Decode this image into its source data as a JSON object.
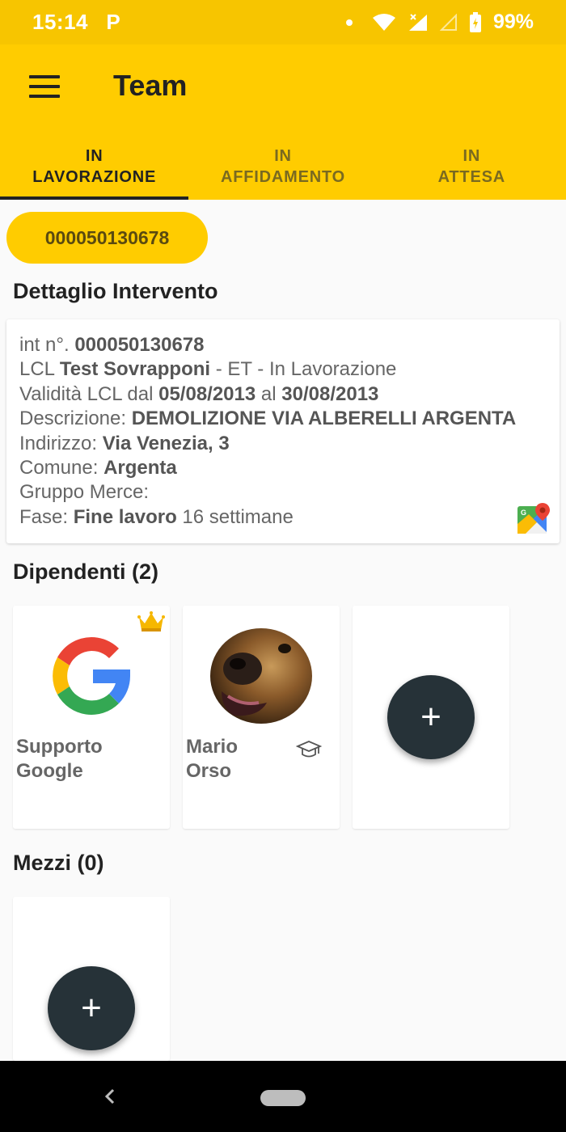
{
  "status_bar": {
    "time": "15:14",
    "parking_glyph": "P",
    "battery": "99%"
  },
  "app_bar": {
    "title": "Team",
    "menu_icon": "menu-icon"
  },
  "tabs": [
    {
      "line1": "IN",
      "line2": "LAVORAZIONE",
      "active": true
    },
    {
      "line1": "IN",
      "line2": "AFFIDAMENTO",
      "active": false
    },
    {
      "line1": "IN",
      "line2": "ATTESA",
      "active": false
    }
  ],
  "chip": {
    "label": "000050130678"
  },
  "detail": {
    "section_title": "Dettaglio Intervento",
    "int_label": "int n°.",
    "int_value": "000050130678",
    "lcl_label": "LCL",
    "lcl_value": "Test Sovrapponi",
    "lcl_suffix": "- ET - In Lavorazione",
    "validity_label": "Validità LCL dal",
    "validity_from": "05/08/2013",
    "validity_al": "al",
    "validity_to": "30/08/2013",
    "descrizione_label": "Descrizione:",
    "descrizione_value": "DEMOLIZIONE VIA ALBERELLI ARGENTA",
    "indirizzo_label": "Indirizzo:",
    "indirizzo_value": "Via Venezia, 3",
    "comune_label": "Comune:",
    "comune_value": "Argenta",
    "gruppo_label": "Gruppo Merce:",
    "fase_label": "Fase:",
    "fase_value": "Fine lavoro",
    "fase_suffix": "16 settimane"
  },
  "dipendenti": {
    "title": "Dipendenti (2)",
    "employees": [
      {
        "first": "Supporto",
        "last": "Google",
        "avatar": "google-logo",
        "badge": "crown-icon"
      },
      {
        "first": "Mario",
        "last": "Orso",
        "avatar": "bear-photo",
        "badge": "graduation-cap-icon"
      }
    ],
    "add_label": "+"
  },
  "mezzi": {
    "title": "Mezzi (0)",
    "add_label": "+"
  },
  "colors": {
    "status_bar": "#f7c500",
    "primary": "#ffcc00",
    "fab": "#263238"
  }
}
